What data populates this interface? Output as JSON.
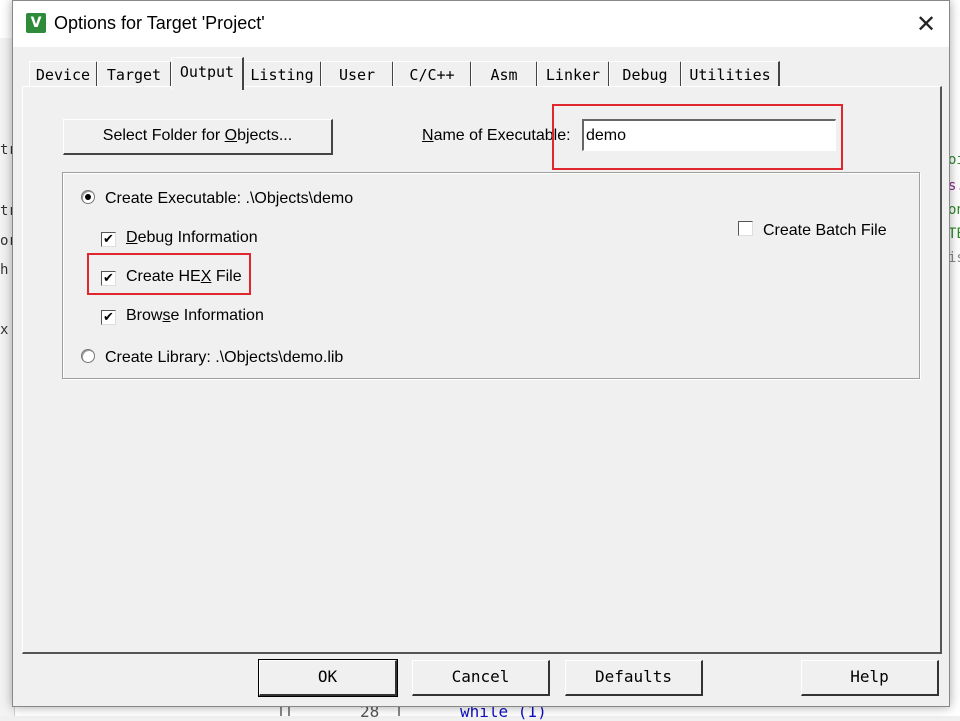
{
  "window": {
    "title": "Options for Target 'Project'",
    "app_icon": "keil-uvision-icon",
    "close_glyph": "✕"
  },
  "tabs": [
    {
      "label": "Device",
      "active": false
    },
    {
      "label": "Target",
      "active": false
    },
    {
      "label": "Output",
      "active": true
    },
    {
      "label": "Listing",
      "active": false
    },
    {
      "label": "User",
      "active": false
    },
    {
      "label": "C/C++",
      "active": false
    },
    {
      "label": "Asm",
      "active": false
    },
    {
      "label": "Linker",
      "active": false
    },
    {
      "label": "Debug",
      "active": false
    },
    {
      "label": "Utilities",
      "active": false
    }
  ],
  "output": {
    "select_folder_pre": "Select Folder for ",
    "select_folder_u": "O",
    "select_folder_post": "bjects...",
    "name_label_pre": "",
    "name_label_u": "N",
    "name_label_post": "ame of Executable:",
    "name_value": "demo",
    "create_exe_pre": "Create Executable:  .\\Objects\\demo",
    "create_exe_selected": true,
    "debug_info_u": "D",
    "debug_info_post": "ebug Information",
    "debug_info_checked": true,
    "hex_pre": "Create HE",
    "hex_u": "X",
    "hex_post": " File",
    "hex_checked": true,
    "browse_pre": "Brow",
    "browse_u": "s",
    "browse_post": "e Information",
    "browse_checked": true,
    "create_lib_label": "Create Library:  .\\Objects\\demo.lib",
    "create_lib_selected": false,
    "batch_label": "Create Batch File",
    "batch_checked": false,
    "check_glyph": "✔"
  },
  "buttons": {
    "ok": "OK",
    "cancel": "Cancel",
    "defaults": "Defaults",
    "help": "Help"
  },
  "background_editor": {
    "line_number": "28",
    "code": "while (1)",
    "fragments": [
      "tr",
      "or",
      "h",
      "x",
      "oi",
      "s.",
      "on",
      "TE",
      "is"
    ]
  },
  "colors": {
    "highlight": "#e0262e",
    "keyword": "#1010c0"
  }
}
